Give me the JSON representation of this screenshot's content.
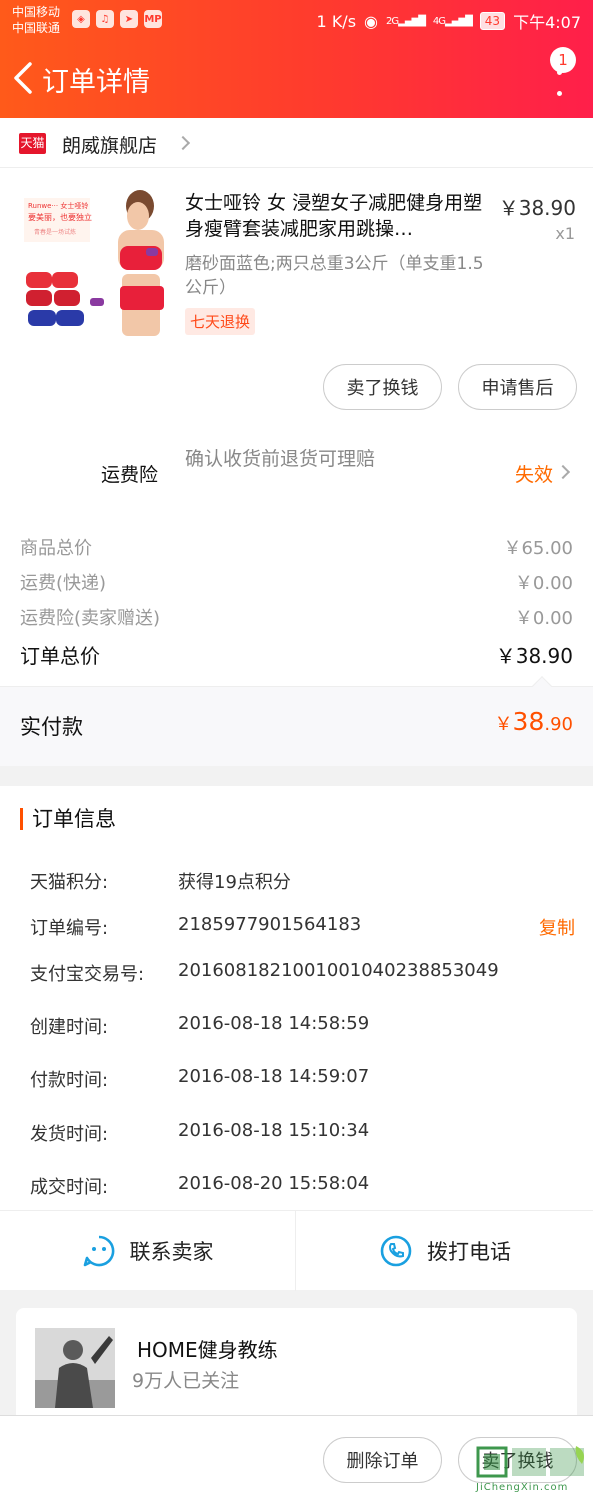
{
  "status_bar": {
    "carrier_1": "中国移动",
    "carrier_2": "中国联通",
    "net_speed": "1 K/s",
    "signal_2g": "2G",
    "signal_4g": "4G",
    "battery": "43",
    "time": "下午4:07"
  },
  "header": {
    "title": "订单详情",
    "badge_count": "1"
  },
  "store": {
    "logo_text": "天猫",
    "name": "朗威旗舰店"
  },
  "product": {
    "title": "女士哑铃 女 浸塑女子减肥健身用塑身瘦臂套装减肥家用跳操…",
    "price": "￥38.90",
    "qty": "x1",
    "spec": "磨砂面蓝色;两只总重3公斤（单支重1.5公斤）",
    "tag": "七天退换",
    "sell_button": "卖了换钱",
    "after_sale_button": "申请售后"
  },
  "insurance": {
    "label": "运费险",
    "desc": "确认收货前退货可理赔",
    "status": "失效"
  },
  "prices": {
    "goods_total_label": "商品总价",
    "goods_total": "￥65.00",
    "shipping_label": "运费(快递)",
    "shipping": "￥0.00",
    "insurance_label": "运费险(卖家赠送)",
    "insurance": "￥0.00",
    "order_total_label": "订单总价",
    "order_total": "￥38.90",
    "paid_label": "实付款",
    "paid_currency": "￥",
    "paid_int": "38",
    "paid_dec": ".90"
  },
  "order_info": {
    "title": "订单信息",
    "points_label": "天猫积分:",
    "points": "获得19点积分",
    "order_no_label": "订单编号:",
    "order_no": "2185977901564183",
    "copy": "复制",
    "alipay_label": "支付宝交易号:",
    "alipay_no": "2016081821001001040238853049",
    "created_label": "创建时间:",
    "created": "2016-08-18 14:58:59",
    "paid_time_label": "付款时间:",
    "paid_time": "2016-08-18 14:59:07",
    "shipped_label": "发货时间:",
    "shipped": "2016-08-18 15:10:34",
    "closed_label": "成交时间:",
    "closed": "2016-08-20 15:58:04"
  },
  "contact": {
    "seller": "联系卖家",
    "call": "拨打电话"
  },
  "coach": {
    "name": "HOME健身教练",
    "followers": "9万人已关注"
  },
  "bottom": {
    "delete_button": "删除订单",
    "sell_button": "卖了换钱"
  },
  "watermark": {
    "text": "JiChengXin.com"
  },
  "colors": {
    "accent": "#ff5000",
    "header_start": "#ff5a1a",
    "header_end": "#ff1f4a"
  }
}
